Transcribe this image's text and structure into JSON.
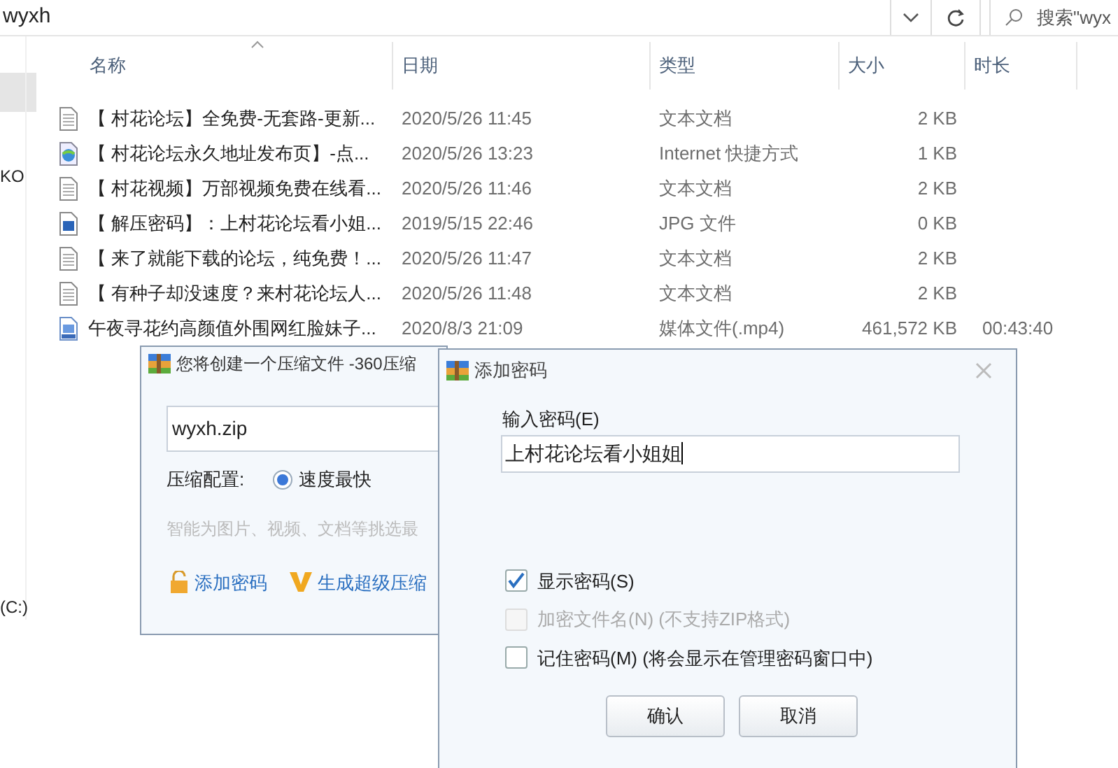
{
  "address_bar": {
    "path": "wyxh"
  },
  "search": {
    "placeholder": "搜索\"wyx"
  },
  "nav_pane": {
    "items": [
      {
        "label": "KO",
        "selected": false
      },
      {
        "label": "(C:)",
        "selected": false
      }
    ],
    "highlight": true
  },
  "columns": [
    "名称",
    "日期",
    "类型",
    "大小",
    "时长"
  ],
  "files": [
    {
      "kind": "text",
      "name": "【 村花论坛】全免费-无套路-更新...",
      "date": "2020/5/26 11:45",
      "type": "文本文档",
      "size": "2 KB"
    },
    {
      "kind": "url",
      "name": "【 村花论坛永久地址发布页】-点...",
      "date": "2020/5/26 13:23",
      "type": "Internet 快捷方式",
      "size": "1 KB"
    },
    {
      "kind": "text",
      "name": "【 村花视频】万部视频免费在线看...",
      "date": "2020/5/26 11:46",
      "type": "文本文档",
      "size": "2 KB"
    },
    {
      "kind": "image",
      "name": "【 解压密码】：上村花论坛看小姐...",
      "date": "2019/5/15 22:46",
      "type": "JPG 文件",
      "size": "0 KB"
    },
    {
      "kind": "text",
      "name": "【 来了就能下载的论坛，纯免费！...",
      "date": "2020/5/26 11:47",
      "type": "文本文档",
      "size": "2 KB"
    },
    {
      "kind": "text",
      "name": "【 有种子却没速度？来村花论坛人...",
      "date": "2020/5/26 11:48",
      "type": "文本文档",
      "size": "2 KB"
    },
    {
      "kind": "video",
      "name": "午夜寻花约高颜值外围网红脸妹子...",
      "date": "2020/8/3 21:09",
      "type": "媒体文件(.mp4)",
      "size": "461,572 KB",
      "duration": "00:43:40"
    }
  ],
  "compress_dialog": {
    "title": "您将创建一个压缩文件 -360压缩",
    "filename": "wyxh.zip",
    "config_label": "压缩配置:",
    "options": [
      {
        "label": "速度最快",
        "selected": true
      }
    ],
    "hint": "智能为图片、视频、文档等挑选最",
    "links": [
      {
        "kind": "lock",
        "label": "添加密码"
      },
      {
        "kind": "v",
        "label": "生成超级压缩"
      }
    ]
  },
  "password_dialog": {
    "title": "添加密码",
    "field_label": "输入密码(E)",
    "password": "上村花论坛看小姐姐",
    "options": [
      {
        "label": "显示密码(S)",
        "checked": true,
        "disabled": false
      },
      {
        "label": "加密文件名(N) (不支持ZIP格式)",
        "checked": false,
        "disabled": true
      },
      {
        "label": "记住密码(M) (将会显示在管理密码窗口中)",
        "checked": false,
        "disabled": false
      }
    ],
    "buttons": [
      "确认",
      "取消"
    ]
  }
}
